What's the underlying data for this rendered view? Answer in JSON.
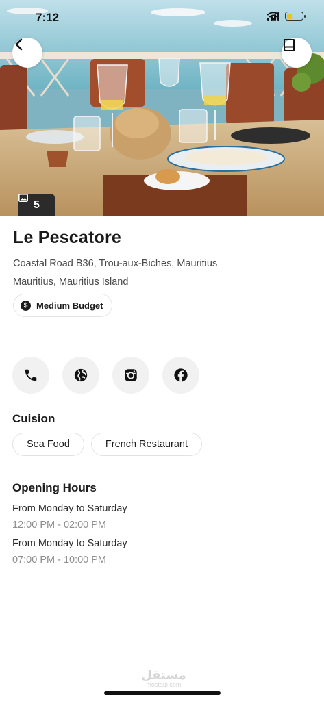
{
  "status_bar": {
    "time": "7:12"
  },
  "header": {
    "back_icon": "chevron-left-icon",
    "book_icon": "book-icon",
    "photo_count": "5"
  },
  "restaurant": {
    "name": "Le Pescatore",
    "address_line1": "Coastal Road B36, Trou-aux-Biches, Mauritius",
    "address_line2": "Mauritius, Mauritius Island",
    "budget": "Medium Budget"
  },
  "contacts": [
    {
      "icon": "phone-icon"
    },
    {
      "icon": "globe-icon"
    },
    {
      "icon": "instagram-icon"
    },
    {
      "icon": "facebook-icon"
    }
  ],
  "cuisine": {
    "title": "Cuision",
    "tags": [
      "Sea Food",
      "French Restaurant"
    ]
  },
  "opening_hours": {
    "title": "Opening Hours",
    "slots": [
      {
        "days": "From Monday to Saturday",
        "time": "12:00 PM - 02:00 PM"
      },
      {
        "days": "From Monday to Saturday",
        "time": "07:00 PM - 10:00 PM"
      }
    ]
  },
  "watermark": {
    "arabic": "مستقل",
    "latin": "mostaql.com"
  },
  "colors": {
    "text": "#1c1c1c",
    "muted": "#8e8e8e",
    "chip_border": "#e2e2e2",
    "icon_bg": "#f1f1f1",
    "battery": "#f2c21a"
  }
}
